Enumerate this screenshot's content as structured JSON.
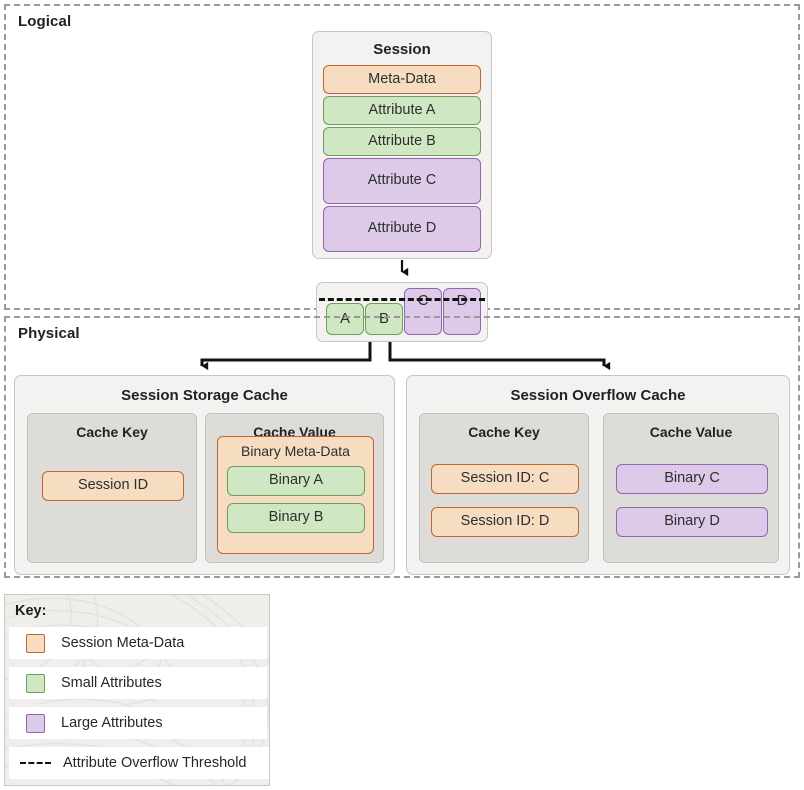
{
  "sections": {
    "logical": {
      "label": "Logical"
    },
    "physical": {
      "label": "Physical"
    }
  },
  "session_card": {
    "title": "Session",
    "blocks": [
      {
        "label": "Meta-Data",
        "kind": "meta"
      },
      {
        "label": "Attribute A",
        "kind": "small"
      },
      {
        "label": "Attribute B",
        "kind": "small"
      },
      {
        "label": "Attribute C",
        "kind": "large"
      },
      {
        "label": "Attribute D",
        "kind": "large"
      }
    ]
  },
  "threshold_card": {
    "blocks": [
      {
        "label": "A",
        "kind": "small"
      },
      {
        "label": "B",
        "kind": "small"
      },
      {
        "label": "C",
        "kind": "large"
      },
      {
        "label": "D",
        "kind": "large"
      }
    ]
  },
  "storage_cache": {
    "title": "Session Storage Cache",
    "key_column": {
      "header": "Cache Key",
      "items": [
        {
          "label": "Session ID",
          "kind": "meta"
        }
      ]
    },
    "value_column": {
      "header": "Cache Value",
      "container_label": "Binary Meta-Data",
      "items": [
        {
          "label": "Binary A",
          "kind": "small"
        },
        {
          "label": "Binary B",
          "kind": "small"
        }
      ]
    }
  },
  "overflow_cache": {
    "title": "Session Overflow Cache",
    "key_column": {
      "header": "Cache Key",
      "items": [
        {
          "label": "Session ID: C",
          "kind": "meta"
        },
        {
          "label": "Session ID: D",
          "kind": "meta"
        }
      ]
    },
    "value_column": {
      "header": "Cache Value",
      "items": [
        {
          "label": "Binary C",
          "kind": "large"
        },
        {
          "label": "Binary D",
          "kind": "large"
        }
      ]
    }
  },
  "key": {
    "title": "Key:",
    "rows": [
      {
        "label": "Session Meta-Data",
        "kind": "meta"
      },
      {
        "label": "Small Attributes",
        "kind": "small"
      },
      {
        "label": "Large Attributes",
        "kind": "large"
      },
      {
        "label": "Attribute Overflow Threshold",
        "kind": "dash"
      }
    ]
  },
  "colors": {
    "meta_fill": "#f6ddc2",
    "meta_border": "#c1662c",
    "small_fill": "#cfe8c3",
    "small_border": "#6d9e5c",
    "large_fill": "#ddcae9",
    "large_border": "#9166b0",
    "panel_fill": "#f3f2f0",
    "panel_inner_fill": "#dedcd8",
    "section_border": "#9a9a9a",
    "connector": "#111111"
  }
}
